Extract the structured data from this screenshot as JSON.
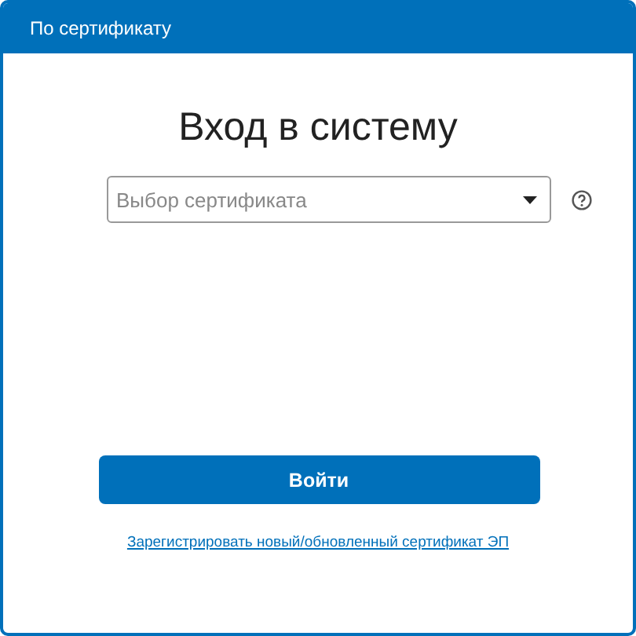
{
  "panel": {
    "title": "По сертификату"
  },
  "heading": "Вход в систему",
  "certificate_select": {
    "placeholder": "Выбор сертификата"
  },
  "login_button": "Войти",
  "register_link": "Зарегистрировать новый/обновленный сертификат ЭП"
}
